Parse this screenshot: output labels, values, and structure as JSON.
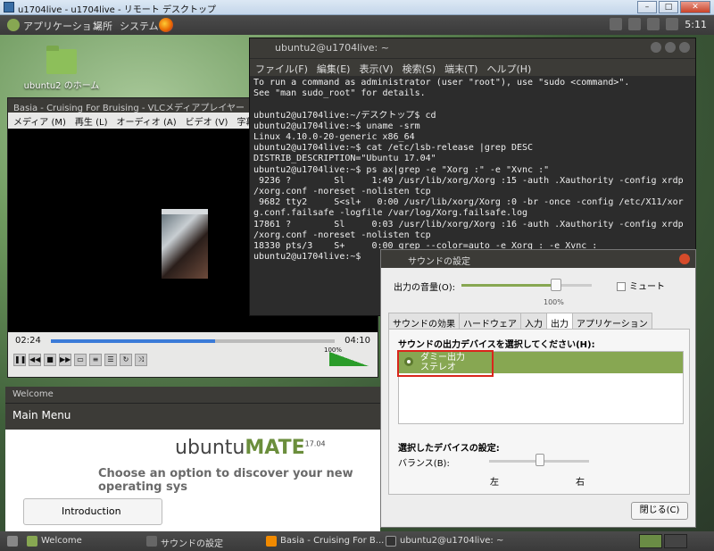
{
  "rdp": {
    "title": "u1704live - u1704live - リモート デスクトップ"
  },
  "top_panel": {
    "menus": [
      "アプリケーション",
      "場所",
      "システム"
    ],
    "clock": "5:11"
  },
  "desktop": {
    "icon_label": "ubuntu2 のホーム"
  },
  "vlc": {
    "title": "Basia - Cruising For Bruising - VLCメディアプレイヤー",
    "menu": [
      "メディア (M)",
      "再生 (L)",
      "オーディオ (A)",
      "ビデオ (V)",
      "字幕 (T)"
    ],
    "elapsed": "02:24",
    "total": "04:10",
    "progress_fraction": 0.58,
    "volume": "100%"
  },
  "welcome": {
    "window_title": "Welcome",
    "main_menu": "Main Menu",
    "logo_ubuntu": "ubuntu",
    "logo_mate": "MATE",
    "logo_version": "17.04",
    "choose": "Choose an option to discover your new operating sys",
    "intro_button": "Introduction"
  },
  "terminal": {
    "title": "ubuntu2@u1704live: ~",
    "menu": [
      "ファイル(F)",
      "編集(E)",
      "表示(V)",
      "検索(S)",
      "端末(T)",
      "ヘルプ(H)"
    ],
    "lines": [
      "To run a command as administrator (user \"root\"), use \"sudo <command>\".",
      "See \"man sudo_root\" for details.",
      "",
      "ubuntu2@u1704live:~/デスクトップ$ cd",
      "ubuntu2@u1704live:~$ uname -srm",
      "Linux 4.10.0-20-generic x86_64",
      "ubuntu2@u1704live:~$ cat /etc/lsb-release |grep DESC",
      "DISTRIB_DESCRIPTION=\"Ubuntu 17.04\"",
      "ubuntu2@u1704live:~$ ps ax|grep -e \"Xorg :\" -e \"Xvnc :\"",
      " 9236 ?        Sl     1:49 /usr/lib/xorg/Xorg :15 -auth .Xauthority -config xrdp",
      "/xorg.conf -noreset -nolisten tcp",
      " 9682 tty2     S<sl+   0:00 /usr/lib/xorg/Xorg :0 -br -once -config /etc/X11/xor",
      "g.conf.failsafe -logfile /var/log/Xorg.failsafe.log",
      "17861 ?        Sl     0:03 /usr/lib/xorg/Xorg :16 -auth .Xauthority -config xrdp",
      "/xorg.conf -noreset -nolisten tcp",
      "18330 pts/3    S+     0:00 grep --color=auto -e Xorg : -e Xvnc :",
      "ubuntu2@u1704live:~$ "
    ]
  },
  "sound": {
    "title": "サウンドの設定",
    "volume_label": "出力の音量(O):",
    "volume_value": "100%",
    "volume_fraction": 0.72,
    "mute_label": "ミュート",
    "tabs": [
      "サウンドの効果",
      "ハードウェア",
      "入力",
      "出力",
      "アプリケーション"
    ],
    "active_tab": "出力",
    "select_label": "サウンドの出力デバイスを選択してください(H):",
    "device_name": "ダミー出力",
    "device_sub": "ステレオ",
    "settings_label": "選択したデバイスの設定:",
    "balance_label": "バランス(B):",
    "left_label": "左",
    "right_label": "右",
    "close_button": "閉じる(C)"
  },
  "taskbar": {
    "items": [
      "Welcome",
      "サウンドの設定",
      "Basia - Cruising For B...",
      "ubuntu2@u1704live: ~"
    ]
  }
}
